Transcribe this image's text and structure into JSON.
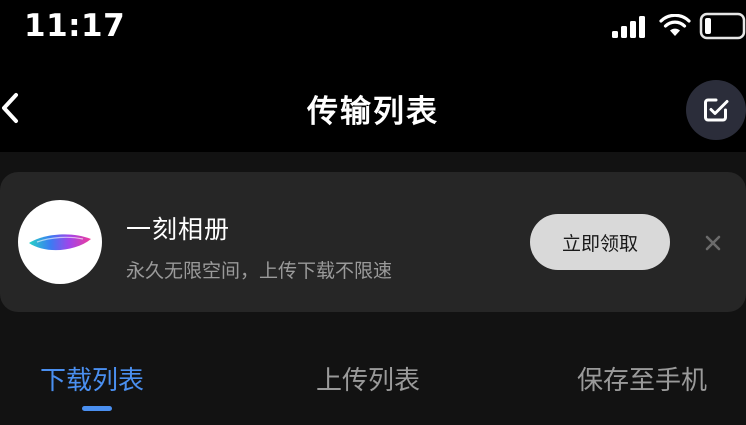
{
  "status_bar": {
    "time": "11:17"
  },
  "nav": {
    "title": "传输列表",
    "back_icon": "chevron-left-icon",
    "edit_icon": "checkbox-edit-icon"
  },
  "promo": {
    "app_name": "一刻相册",
    "description": "永久无限空间，上传下载不限速",
    "claim_label": "立即领取",
    "close_icon": "close-icon"
  },
  "tabs": [
    {
      "label": "下载列表",
      "active": true
    },
    {
      "label": "上传列表",
      "active": false
    },
    {
      "label": "保存至手机",
      "active": false
    }
  ],
  "colors": {
    "accent": "#4a8ff0",
    "background": "#000000",
    "banner": "#262626"
  }
}
